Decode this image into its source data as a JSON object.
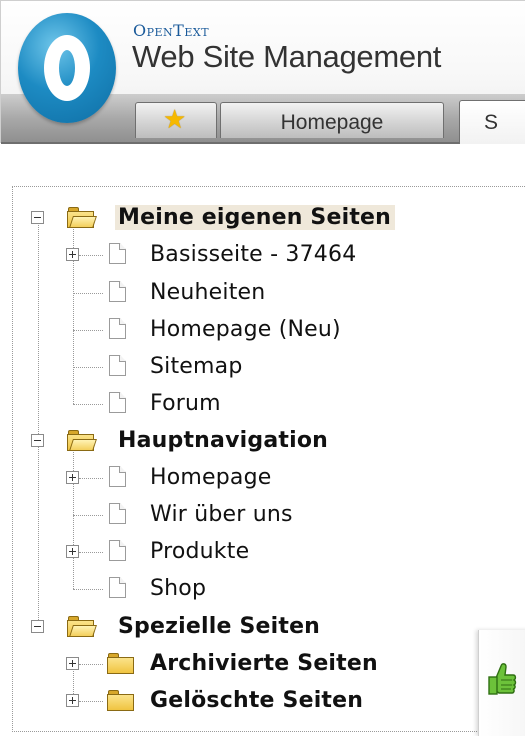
{
  "header": {
    "brand_small": "OpenText",
    "brand_main": "Web Site Management",
    "tabs": [
      {
        "label": "",
        "icon": "star-icon"
      },
      {
        "label": "Homepage"
      },
      {
        "label": "S"
      }
    ]
  },
  "tree": {
    "groups": [
      {
        "label": "Meine eigenen Seiten",
        "items": [
          {
            "label": "Basisseite - 37464",
            "expandable": true
          },
          {
            "label": "Neuheiten",
            "expandable": false
          },
          {
            "label": "Homepage (Neu)",
            "expandable": false
          },
          {
            "label": "Sitemap",
            "expandable": false
          },
          {
            "label": "Forum",
            "expandable": false
          }
        ]
      },
      {
        "label": "Hauptnavigation",
        "items": [
          {
            "label": "Homepage",
            "expandable": true
          },
          {
            "label": "Wir über uns",
            "expandable": false
          },
          {
            "label": "Produkte",
            "expandable": true
          },
          {
            "label": "Shop",
            "expandable": false
          }
        ]
      },
      {
        "label": "Spezielle Seiten",
        "items": [
          {
            "label": "Archivierte Seiten",
            "expandable": true
          },
          {
            "label": "Gelöschte Seiten",
            "expandable": true
          }
        ]
      }
    ]
  },
  "colors": {
    "accent_blue": "#1d8bc3",
    "selected_bg": "#efe8da",
    "folder_yellow": "#f0c441",
    "thumb_green": "#3e9a1f"
  }
}
